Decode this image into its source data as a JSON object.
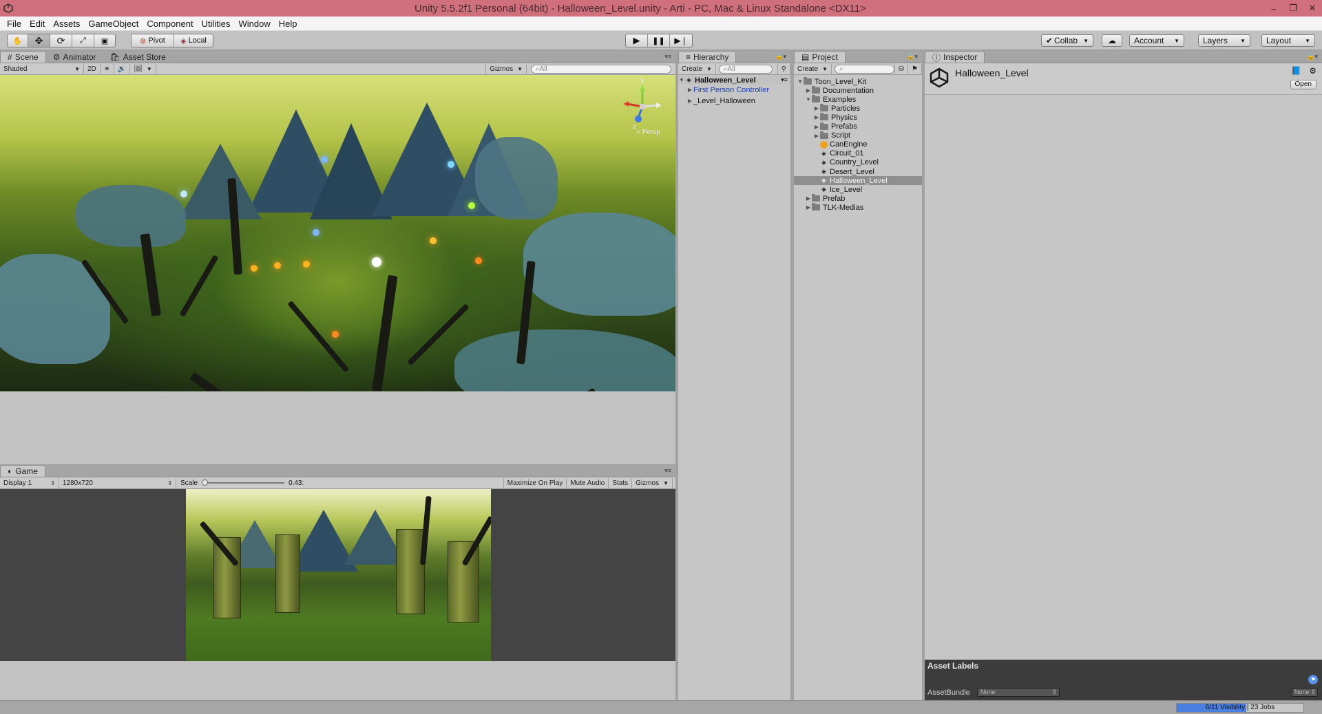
{
  "window": {
    "title": "Unity 5.5.2f1 Personal (64bit) - Halloween_Level.unity - Arti - PC, Mac & Linux Standalone <DX11>",
    "controls": [
      "–",
      "❐",
      "✕"
    ]
  },
  "menu": [
    "File",
    "Edit",
    "Assets",
    "GameObject",
    "Component",
    "Utilities",
    "Window",
    "Help"
  ],
  "toolbar": {
    "pivot": "Pivot",
    "local": "Local",
    "collab": "Collab",
    "account": "Account",
    "layers": "Layers",
    "layout": "Layout"
  },
  "scene": {
    "tabs": [
      "Scene",
      "Animator",
      "Asset Store"
    ],
    "shading": "Shaded",
    "mode_2d": "2D",
    "gizmos": "Gizmos",
    "search_placeholder": "All",
    "persp": "< Persp",
    "axis_y": "y",
    "axis_z": "z"
  },
  "game": {
    "tab": "Game",
    "display": "Display 1",
    "resolution": "1280x720",
    "scale_label": "Scale",
    "scale_value": "0.43:",
    "scale_fraction": 0.0,
    "maximize": "Maximize On Play",
    "mute": "Mute Audio",
    "stats": "Stats",
    "gizmos": "Gizmos"
  },
  "hierarchy": {
    "tab": "Hierarchy",
    "create": "Create",
    "search_placeholder": "All",
    "scene_name": "Halloween_Level",
    "items": [
      {
        "label": "First Person Controller",
        "color": "#1a3fb0"
      },
      {
        "label": "_Level_Halloween",
        "color": "#111111"
      }
    ]
  },
  "project": {
    "tab": "Project",
    "create": "Create",
    "items": [
      {
        "label": "Toon_Level_Kit",
        "indent": 0,
        "arrow": "▼",
        "icon": "folder"
      },
      {
        "label": "Documentation",
        "indent": 1,
        "arrow": "▶",
        "icon": "folder"
      },
      {
        "label": "Examples",
        "indent": 1,
        "arrow": "▼",
        "icon": "folder"
      },
      {
        "label": "Particles",
        "indent": 2,
        "arrow": "▶",
        "icon": "folder"
      },
      {
        "label": "Physics",
        "indent": 2,
        "arrow": "▶",
        "icon": "folder"
      },
      {
        "label": "Prefabs",
        "indent": 2,
        "arrow": "▶",
        "icon": "folder"
      },
      {
        "label": "Script",
        "indent": 2,
        "arrow": "▶",
        "icon": "folder"
      },
      {
        "label": "CanEngine",
        "indent": 2,
        "arrow": "",
        "icon": "audio"
      },
      {
        "label": "Circuit_01",
        "indent": 2,
        "arrow": "",
        "icon": "scene"
      },
      {
        "label": "Country_Level",
        "indent": 2,
        "arrow": "",
        "icon": "scene"
      },
      {
        "label": "Desert_Level",
        "indent": 2,
        "arrow": "",
        "icon": "scene"
      },
      {
        "label": "Halloween_Level",
        "indent": 2,
        "arrow": "",
        "icon": "scene",
        "selected": true
      },
      {
        "label": "Ice_Level",
        "indent": 2,
        "arrow": "",
        "icon": "scene"
      },
      {
        "label": "Prefab",
        "indent": 1,
        "arrow": "▶",
        "icon": "folder"
      },
      {
        "label": "TLK-Medias",
        "indent": 1,
        "arrow": "▶",
        "icon": "folder"
      }
    ]
  },
  "inspector": {
    "tab": "Inspector",
    "asset_name": "Halloween_Level",
    "open": "Open",
    "asset_labels": "Asset Labels",
    "assetbundle_label": "AssetBundle",
    "bundle_value": "None",
    "variant_value": "None"
  },
  "status": {
    "progress_text": "6/11 Visibility | 23 Jobs",
    "progress_fraction": 0.55
  }
}
